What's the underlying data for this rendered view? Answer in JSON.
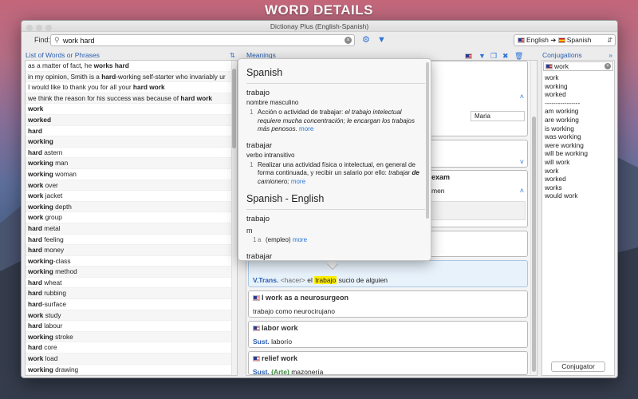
{
  "headline": "WORD DETAILS",
  "window": {
    "title": "Dictionay Plus (English-Spanish)"
  },
  "toolbar": {
    "find_label": "Find:",
    "search_value": "work hard",
    "lang_from": "English",
    "lang_arrow": "➔",
    "lang_to": "Spanish",
    "icons": [
      "search-icon",
      "clear-icon",
      "gear-icon",
      "filter-icon",
      "chevron-updown-icon"
    ]
  },
  "list": {
    "header": "List of Words or Phrases",
    "rows": [
      {
        "pre": "as a matter of fact, he ",
        "bold": "works hard",
        "post": ""
      },
      {
        "pre": "in my opinion, Smith is a ",
        "bold": "hard",
        "post": "-working self-starter who invariably ur"
      },
      {
        "pre": "I would like to thank you for all your ",
        "bold": "hard work",
        "post": ""
      },
      {
        "pre": "we think the reason for his success was because of ",
        "bold": "hard work",
        "post": ""
      },
      {
        "pre": "",
        "bold": "work",
        "post": ""
      },
      {
        "pre": "",
        "bold": "worked",
        "post": ""
      },
      {
        "pre": "",
        "bold": "hard",
        "post": ""
      },
      {
        "pre": "",
        "bold": "working",
        "post": ""
      },
      {
        "pre": "",
        "bold": "hard",
        "post": " astern"
      },
      {
        "pre": "",
        "bold": "working",
        "post": " man"
      },
      {
        "pre": "",
        "bold": "working",
        "post": " woman"
      },
      {
        "pre": "",
        "bold": "work",
        "post": " over"
      },
      {
        "pre": "",
        "bold": "work",
        "post": " jacket"
      },
      {
        "pre": "",
        "bold": "working",
        "post": " depth"
      },
      {
        "pre": "",
        "bold": "work",
        "post": " group"
      },
      {
        "pre": "",
        "bold": "hard",
        "post": " metal"
      },
      {
        "pre": "",
        "bold": "hard",
        "post": " feeling"
      },
      {
        "pre": "",
        "bold": "hard",
        "post": " money"
      },
      {
        "pre": "",
        "bold": "working",
        "post": "-class"
      },
      {
        "pre": "",
        "bold": "working",
        "post": " method"
      },
      {
        "pre": "",
        "bold": "hard",
        "post": " wheat"
      },
      {
        "pre": "",
        "bold": "hard",
        "post": " rubbing"
      },
      {
        "pre": "",
        "bold": "hard",
        "post": "-surface"
      },
      {
        "pre": "",
        "bold": "work",
        "post": " study"
      },
      {
        "pre": "",
        "bold": "hard",
        "post": " labour"
      },
      {
        "pre": "",
        "bold": "working",
        "post": " stroke"
      },
      {
        "pre": "",
        "bold": "hard",
        "post": " core"
      },
      {
        "pre": "",
        "bold": "work",
        "post": " load"
      },
      {
        "pre": "",
        "bold": "working",
        "post": " drawing"
      }
    ]
  },
  "meanings": {
    "header": "Meanings",
    "icons": [
      "flag-us-icon",
      "filter-icon",
      "copy-icon",
      "delete-icon",
      "trash-icon"
    ],
    "field_maria": "Maria",
    "partial_exam": "exam",
    "partial_men": "men",
    "cards": [
      {
        "en": "",
        "pos": "V.Trans.",
        "tag": "<hacer>",
        "pre": " el ",
        "hl": "trabajo",
        "post": " sucio de alguien"
      },
      {
        "en": "I work as a neurosurgeon",
        "pos": "",
        "tag": "",
        "pre": "trabajo como neurocirujano",
        "hl": "",
        "post": ""
      },
      {
        "en": "labor work",
        "pos": "Sust.",
        "tag": "",
        "pre": " laborío",
        "hl": "",
        "post": ""
      },
      {
        "en": "relief work",
        "pos": "Sust.",
        "tag": "(Arte)",
        "pre": " mazonería",
        "hl": "",
        "post": ""
      }
    ]
  },
  "popover": {
    "section1_title": "Spanish",
    "entry1_word": "trabajo",
    "entry1_pos": "nombre masculino",
    "entry1_num": "1",
    "entry1_def": "Acción o actividad de trabajar: ",
    "entry1_ex": "el trabajo intelectual requiere mucha concentración; le encargan los trabajos más penosos.",
    "entry2_word": "trabajar",
    "entry2_pos": "verbo intransitivo",
    "entry2_num": "1",
    "entry2_def": "Realizar una actividad física o intelectual, en general de forma continuada, y recibir un salario por ello: ",
    "entry2_ex_a": "trabajar ",
    "entry2_ex_b": "de",
    "entry2_ex_c": " camionero;",
    "more": "more",
    "section2_title": "Spanish - English",
    "entry3_word": "trabajo",
    "entry3_gender": "m",
    "entry3_num": "1",
    "entry3_sub": "a",
    "entry3_def": "(empleo)",
    "entry4_word": "trabajar"
  },
  "conjugations": {
    "header": "Conjugations",
    "input_value": "work",
    "rows": [
      "work",
      "working",
      "worked",
      "----------------",
      "am working",
      "are working",
      "is working",
      "was working",
      "were working",
      "will be working",
      "will work",
      "work",
      "worked",
      "works",
      "would work"
    ],
    "button": "Conjugator"
  }
}
